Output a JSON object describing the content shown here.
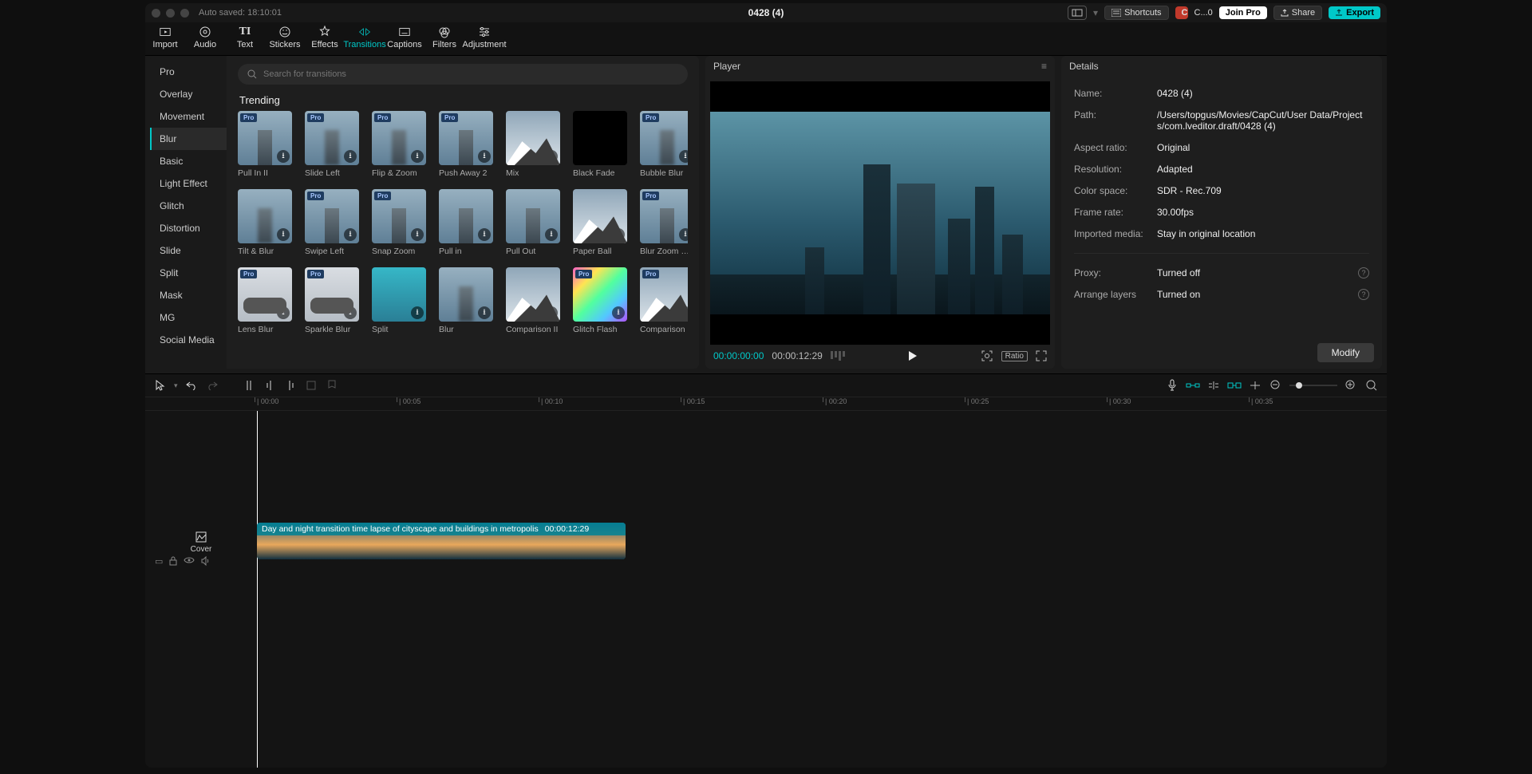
{
  "titlebar": {
    "autosave": "Auto saved: 18:10:01",
    "title": "0428 (4)",
    "shortcuts": "Shortcuts",
    "user_initial": "C",
    "credits": "C...0",
    "join_pro": "Join Pro",
    "share": "Share",
    "export": "Export"
  },
  "tool_tabs": [
    "Import",
    "Audio",
    "Text",
    "Stickers",
    "Effects",
    "Transitions",
    "Captions",
    "Filters",
    "Adjustment"
  ],
  "active_tool_tab": "Transitions",
  "categories": [
    "Pro",
    "Overlay",
    "Movement",
    "Blur",
    "Basic",
    "Light Effect",
    "Glitch",
    "Distortion",
    "Slide",
    "Split",
    "Mask",
    "MG",
    "Social Media"
  ],
  "active_category": "Blur",
  "search_placeholder": "Search for transitions",
  "section_title": "Trending",
  "transitions": [
    {
      "label": "Pull In II",
      "pro": true,
      "dl": true,
      "style": "bld"
    },
    {
      "label": "Slide Left",
      "pro": true,
      "dl": true,
      "style": "blur"
    },
    {
      "label": "Flip & Zoom",
      "pro": true,
      "dl": true,
      "style": "blur"
    },
    {
      "label": "Push Away 2",
      "pro": true,
      "dl": true,
      "style": "bld"
    },
    {
      "label": "Mix",
      "pro": false,
      "dl": true,
      "style": "mtn"
    },
    {
      "label": "Black Fade",
      "pro": false,
      "dl": false,
      "style": "black"
    },
    {
      "label": "Bubble Blur",
      "pro": true,
      "dl": true,
      "style": "blur"
    },
    {
      "label": "Tilt & Blur",
      "pro": false,
      "dl": true,
      "style": "blur"
    },
    {
      "label": "Swipe Left",
      "pro": true,
      "dl": true,
      "style": "bld"
    },
    {
      "label": "Snap Zoom",
      "pro": true,
      "dl": true,
      "style": "bld"
    },
    {
      "label": "Pull in",
      "pro": false,
      "dl": true,
      "style": "bld"
    },
    {
      "label": "Pull Out",
      "pro": false,
      "dl": true,
      "style": "bld"
    },
    {
      "label": "Paper Ball",
      "pro": false,
      "dl": true,
      "style": "mtn"
    },
    {
      "label": "Blur Zoom Out",
      "pro": true,
      "dl": true,
      "style": "bld"
    },
    {
      "label": "Lens Blur",
      "pro": true,
      "dl": true,
      "style": "car"
    },
    {
      "label": "Sparkle Blur",
      "pro": true,
      "dl": true,
      "style": "car"
    },
    {
      "label": "Split",
      "pro": false,
      "dl": true,
      "style": "blue"
    },
    {
      "label": "Blur",
      "pro": false,
      "dl": true,
      "style": "blur"
    },
    {
      "label": "Comparison II",
      "pro": false,
      "dl": true,
      "style": "mtn"
    },
    {
      "label": "Glitch Flash",
      "pro": true,
      "dl": true,
      "style": "rainbow"
    },
    {
      "label": "Comparison",
      "pro": true,
      "dl": true,
      "style": "mtn"
    }
  ],
  "player": {
    "title": "Player",
    "cur": "00:00:00:00",
    "dur": "00:00:12:29",
    "ratio": "Ratio"
  },
  "details": {
    "title": "Details",
    "rows": {
      "Name": "0428 (4)",
      "Path": "/Users/topgus/Movies/CapCut/User Data/Projects/com.lveditor.draft/0428 (4)",
      "Aspect_ratio": "Original",
      "Resolution": "Adapted",
      "Color_space": "SDR - Rec.709",
      "Frame_rate": "30.00fps",
      "Imported_media": "Stay in original location",
      "Proxy": "Turned off",
      "Arrange_layers": "Turned on"
    },
    "modify": "Modify"
  },
  "timeline": {
    "ticks": [
      "00:00",
      "00:05",
      "00:10",
      "00:15",
      "00:20",
      "00:25",
      "00:30",
      "00:35"
    ],
    "clip_name": "Day and night transition time lapse of cityscape and buildings in metropolis",
    "clip_dur": "00:00:12:29",
    "cover": "Cover"
  }
}
